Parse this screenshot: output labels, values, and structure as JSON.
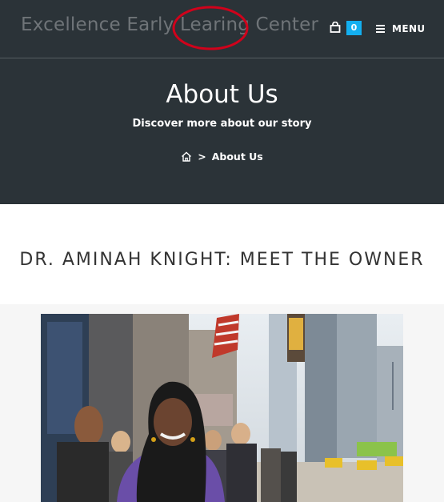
{
  "header": {
    "site_title": "Excellence Early Learing Center",
    "cart_count": "0",
    "menu_label": "MENU",
    "icons": {
      "cart": "shopping-bag-icon",
      "menu": "hamburger-icon"
    }
  },
  "hero": {
    "title": "About Us",
    "subtitle": "Discover more about our story",
    "breadcrumb": {
      "home_icon": "home-icon",
      "separator": ">",
      "current": "About Us"
    }
  },
  "content": {
    "owner_heading": "DR. AMINAH KNIGHT: MEET THE OWNER"
  },
  "colors": {
    "header_bg": "#2b3338",
    "accent": "#13aff0",
    "annotation_circle": "#d0021b"
  }
}
